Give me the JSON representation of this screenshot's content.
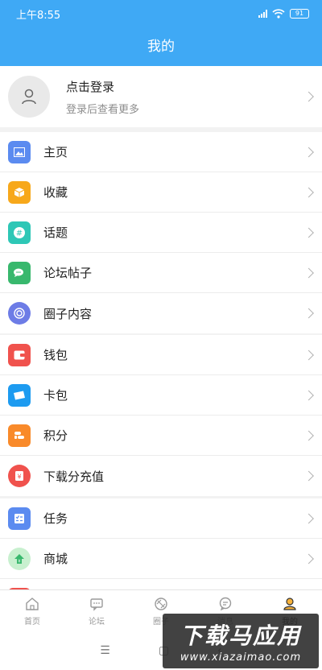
{
  "status": {
    "time": "上午8:55",
    "battery": "91"
  },
  "header": {
    "title": "我的"
  },
  "profile": {
    "title": "点击登录",
    "subtitle": "登录后查看更多"
  },
  "group1": [
    {
      "label": "主页",
      "icon": "image-icon",
      "color": "#5b8bf0"
    },
    {
      "label": "收藏",
      "icon": "box-icon",
      "color": "#f7a81b"
    },
    {
      "label": "话题",
      "icon": "hashtag-icon",
      "color": "#2ec7b6"
    },
    {
      "label": "论坛帖子",
      "icon": "chat-bubbles-icon",
      "color": "#38b86d"
    },
    {
      "label": "圈子内容",
      "icon": "circle-target-icon",
      "color": "#6d7ce6"
    }
  ],
  "group2": [
    {
      "label": "钱包",
      "icon": "wallet-icon",
      "color": "#f0524d"
    },
    {
      "label": "卡包",
      "icon": "card-icon",
      "color": "#1d9bf0"
    },
    {
      "label": "积分",
      "icon": "coins-icon",
      "color": "#f98a2a"
    },
    {
      "label": "下载分充值",
      "icon": "red-envelope-icon",
      "color": "#f0524d"
    }
  ],
  "group3": [
    {
      "label": "任务",
      "icon": "checklist-icon",
      "color": "#5b8bf0"
    },
    {
      "label": "商城",
      "icon": "shop-icon",
      "color": "#c8f0cf"
    }
  ],
  "tabs": [
    {
      "label": "首页",
      "icon": "home-icon"
    },
    {
      "label": "论坛",
      "icon": "forum-icon"
    },
    {
      "label": "圈子",
      "icon": "circle-icon"
    },
    {
      "label": "消息",
      "icon": "message-icon"
    },
    {
      "label": "我的",
      "icon": "user-icon",
      "active": true
    }
  ],
  "watermark": {
    "title": "下载马应用",
    "url": "www.xiazaimao.com"
  }
}
